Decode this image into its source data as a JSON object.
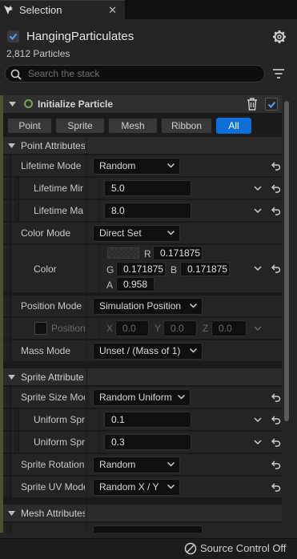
{
  "tab": {
    "title": "Selection",
    "close": "✕"
  },
  "header": {
    "emitter_name": "HangingParticulates",
    "particle_count": "2,812 Particles"
  },
  "search": {
    "placeholder": "Search the stack"
  },
  "module": {
    "title": "Initialize Particle",
    "view_tabs": [
      {
        "label": "Point",
        "active": false
      },
      {
        "label": "Sprite",
        "active": false
      },
      {
        "label": "Mesh",
        "active": false
      },
      {
        "label": "Ribbon",
        "active": false
      },
      {
        "label": "All",
        "active": true
      }
    ]
  },
  "point_attributes": {
    "title": "Point Attributes",
    "lifetime_mode": {
      "label": "Lifetime Mode",
      "value": "Random"
    },
    "lifetime_min": {
      "label": "Lifetime Mir",
      "value": "5.0"
    },
    "lifetime_max": {
      "label": "Lifetime Ma",
      "value": "8.0"
    },
    "color_mode": {
      "label": "Color Mode",
      "value": "Direct Set"
    },
    "color": {
      "label": "Color",
      "r_label": "R",
      "r": "0.171875",
      "g_label": "G",
      "g": "0.171875",
      "b_label": "B",
      "b": "0.171875",
      "a_label": "A",
      "a": "0.958"
    },
    "position_mode": {
      "label": "Position Mode",
      "value": "Simulation Position"
    },
    "position": {
      "label": "Position",
      "x_label": "X",
      "x": "0.0",
      "y_label": "Y",
      "y": "0.0",
      "z_label": "Z",
      "z": "0.0"
    },
    "mass_mode": {
      "label": "Mass Mode",
      "value": "Unset / (Mass of 1)"
    }
  },
  "sprite_attributes": {
    "title": "Sprite Attribute",
    "size_mode": {
      "label": "Sprite Size Moc",
      "value": "Random Uniform"
    },
    "uniform_min": {
      "label": "Uniform Spr",
      "value": "0.1"
    },
    "uniform_max": {
      "label": "Uniform Spr",
      "value": "0.3"
    },
    "rotation": {
      "label": "Sprite Rotation",
      "value": "Random"
    },
    "uv_mode": {
      "label": "Sprite UV Mode",
      "value": "Random X / Y"
    }
  },
  "mesh_attributes": {
    "title": "Mesh Attributes"
  },
  "status_bar": {
    "source_control": "Source Control Off"
  },
  "colors": {
    "accent": "#0c6fd8",
    "module_stripe": "#4b5430",
    "module_icon": "#7fa055"
  }
}
